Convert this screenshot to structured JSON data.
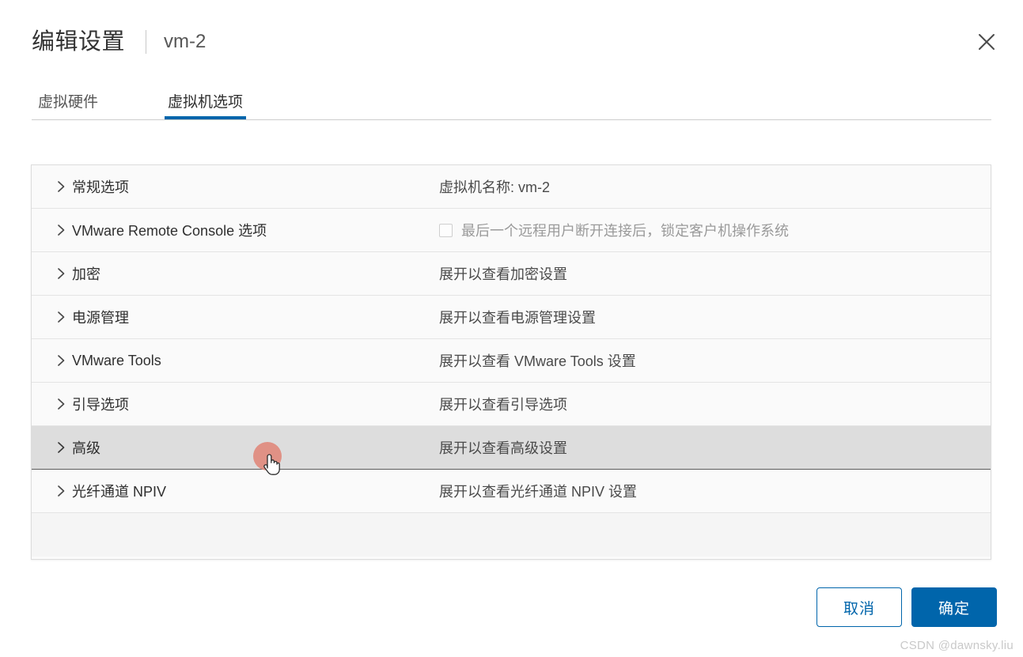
{
  "theme": {
    "accent": "#0065ab",
    "highlight_row_bg": "#dddddd",
    "click_halo": "#e08a7d",
    "watermark_color": "#c9c9c9"
  },
  "header": {
    "title": "编辑设置",
    "separator": "|",
    "subtitle": "vm-2",
    "close_icon": "close-icon"
  },
  "tabs": [
    {
      "label": "虚拟硬件",
      "active": false
    },
    {
      "label": "虚拟机选项",
      "active": true
    }
  ],
  "options_table": {
    "rows": [
      {
        "label": "常规选项",
        "value": "虚拟机名称: vm-2",
        "expand_icon": "chevron-right-icon",
        "has_checkbox": false,
        "muted": false,
        "highlighted": false
      },
      {
        "label": "VMware Remote Console 选项",
        "value": "最后一个远程用户断开连接后，锁定客户机操作系统",
        "expand_icon": "chevron-right-icon",
        "has_checkbox": true,
        "checkbox_checked": false,
        "muted": true,
        "highlighted": false
      },
      {
        "label": "加密",
        "value": "展开以查看加密设置",
        "expand_icon": "chevron-right-icon",
        "has_checkbox": false,
        "muted": false,
        "highlighted": false
      },
      {
        "label": "电源管理",
        "value": "展开以查看电源管理设置",
        "expand_icon": "chevron-right-icon",
        "has_checkbox": false,
        "muted": false,
        "highlighted": false
      },
      {
        "label": "VMware Tools",
        "value": "展开以查看 VMware Tools 设置",
        "expand_icon": "chevron-right-icon",
        "has_checkbox": false,
        "muted": false,
        "highlighted": false
      },
      {
        "label": "引导选项",
        "value": "展开以查看引导选项",
        "expand_icon": "chevron-right-icon",
        "has_checkbox": false,
        "muted": false,
        "highlighted": false
      },
      {
        "label": "高级",
        "value": "展开以查看高级设置",
        "expand_icon": "chevron-right-icon",
        "has_checkbox": false,
        "muted": false,
        "highlighted": true
      },
      {
        "label": "光纤通道 NPIV",
        "value": "展开以查看光纤通道 NPIV 设置",
        "expand_icon": "chevron-right-icon",
        "has_checkbox": false,
        "muted": false,
        "highlighted": false
      }
    ]
  },
  "footer": {
    "cancel_label": "取消",
    "ok_label": "确定"
  },
  "watermark": {
    "text": "CSDN @dawnsky.liu"
  }
}
